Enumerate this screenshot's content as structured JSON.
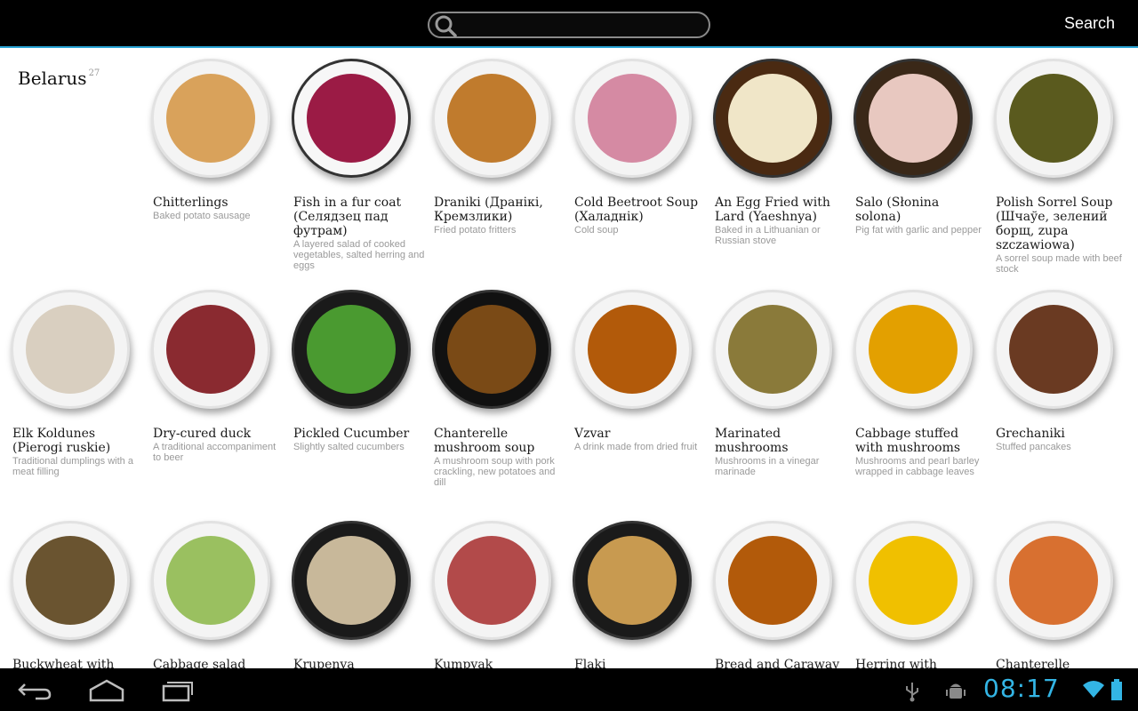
{
  "search": {
    "placeholder": "",
    "value": "",
    "button_label": "Search"
  },
  "country": {
    "name": "Belarus",
    "count": "27"
  },
  "dishes": [
    {
      "name": "Chitterlings",
      "desc": "Baked potato sausage"
    },
    {
      "name": "Fish in a fur coat (Селядзец пад футрам)",
      "desc": "A layered salad of cooked vegetables, salted herring and eggs"
    },
    {
      "name": "Draniki (Дранікі, Кремзлики)",
      "desc": "Fried potato fritters"
    },
    {
      "name": "Cold Beetroot Soup (Халаднік)",
      "desc": "Cold soup"
    },
    {
      "name": "An Egg Fried with Lard (Yaeshnya)",
      "desc": "Baked in a Lithuanian or Russian stove"
    },
    {
      "name": "Salo (Słonina solona)",
      "desc": "Pig fat with garlic and pepper"
    },
    {
      "name": "Polish Sorrel Soup (Шчаўе, зелений борщ, zupa szczawiowa)",
      "desc": "A sorrel soup made with beef stock"
    },
    {
      "name": "Elk Koldunes (Pierogi ruskie)",
      "desc": "Traditional dumplings with a meat filling"
    },
    {
      "name": "Dry-cured duck",
      "desc": "A traditional accompaniment to beer"
    },
    {
      "name": "Pickled Cucumber",
      "desc": "Slightly salted cucumbers"
    },
    {
      "name": "Chanterelle mushroom soup",
      "desc": "A mushroom soup with pork crackling, new potatoes and dill"
    },
    {
      "name": "Vzvar",
      "desc": "A drink made from dried fruit"
    },
    {
      "name": "Marinated mushrooms",
      "desc": "Mushrooms in a vinegar marinade"
    },
    {
      "name": "Cabbage stuffed with mushrooms",
      "desc": "Mushrooms and pearl barley wrapped in cabbage leaves"
    },
    {
      "name": "Grechaniki",
      "desc": "Stuffed pancakes"
    },
    {
      "name": "Buckwheat with",
      "desc": ""
    },
    {
      "name": "Cabbage salad",
      "desc": ""
    },
    {
      "name": "Krupenya",
      "desc": ""
    },
    {
      "name": "Kumpyak",
      "desc": ""
    },
    {
      "name": "Flaki",
      "desc": ""
    },
    {
      "name": "Bread and Caraway",
      "desc": ""
    },
    {
      "name": "Herring with",
      "desc": ""
    },
    {
      "name": "Chanterelle",
      "desc": ""
    }
  ],
  "icons": {
    "search": "search-icon",
    "back": "back-icon",
    "home": "home-icon",
    "recents": "recent-apps-icon",
    "usb": "usb-icon",
    "debug": "android-debug-icon",
    "wifi": "wifi-icon",
    "battery": "battery-icon"
  },
  "status": {
    "time": "08:17"
  },
  "colors": {
    "accent": "#33b5e5",
    "topbar": "#000000"
  }
}
